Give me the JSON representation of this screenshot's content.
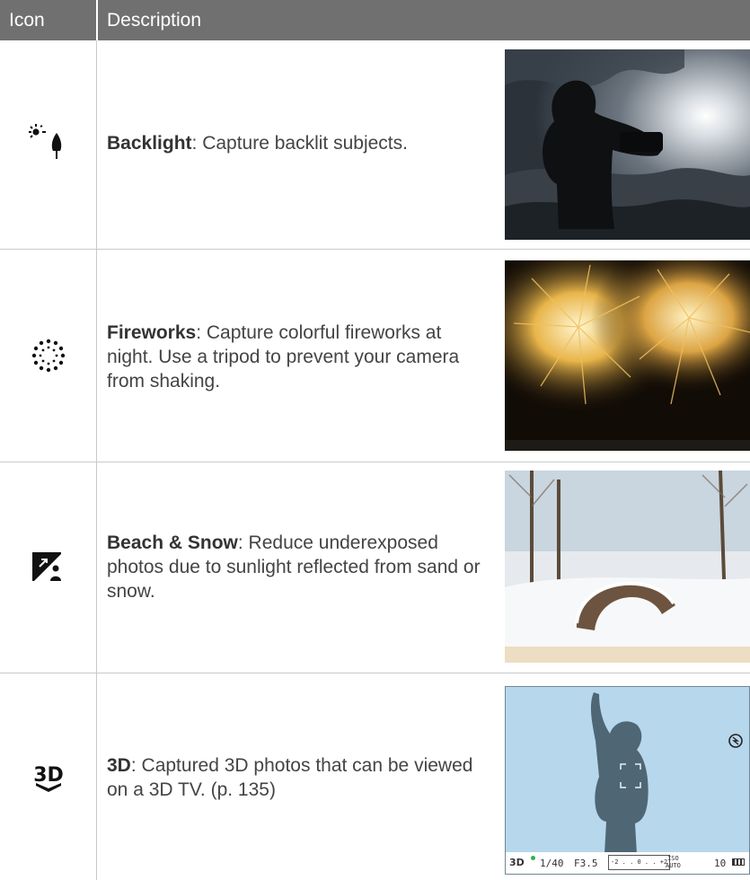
{
  "header": {
    "icon_label": "Icon",
    "description_label": "Description"
  },
  "rows": [
    {
      "icon": "backlight-icon",
      "term": "Backlight",
      "text": ": Capture backlit subjects.",
      "photo": "backlit-silhouette-photo"
    },
    {
      "icon": "fireworks-icon",
      "term": "Fireworks",
      "text": ": Capture colorful fireworks at night. Use a tripod to prevent your camera from shaking.",
      "photo": "fireworks-photo"
    },
    {
      "icon": "beach-snow-icon",
      "term": "Beach & Snow",
      "text": ": Reduce underexposed photos due to sunlight reflected from sand or snow.",
      "photo": "snow-park-photo"
    },
    {
      "icon": "3d-icon",
      "term": "3D",
      "text": ": Captured 3D photos that can be viewed on a 3D TV. (p. 135)",
      "photo": "3d-viewfinder-screen"
    }
  ],
  "viewfinder": {
    "mode_glyph": "3D",
    "shutter": "1/40",
    "aperture": "F3.5",
    "ev_scale": "-2 . . 0 . . +2",
    "iso_top": "ISO",
    "iso_bottom": "AUTO",
    "shots": "10"
  },
  "colors": {
    "header_bg": "#707070",
    "rule": "#c9c9c9",
    "screen_bg": "#b7d7ec",
    "silhouette": "#4f6674"
  }
}
